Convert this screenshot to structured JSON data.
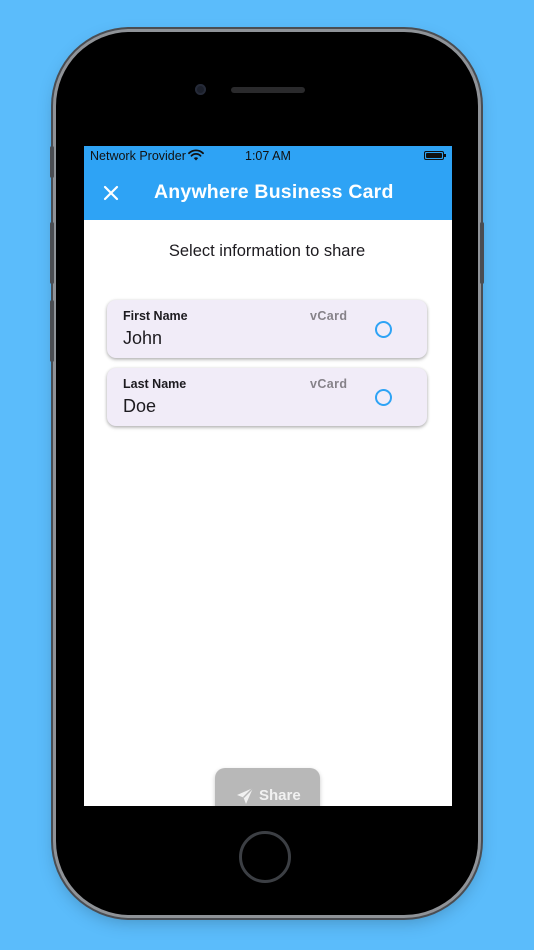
{
  "status_bar": {
    "carrier": "Network Provider",
    "time": "1:07 AM",
    "wifi_icon": "wifi-icon",
    "battery_icon": "battery-icon"
  },
  "app_bar": {
    "title": "Anywhere Business Card",
    "close_icon": "close-icon",
    "color": "#2ea3f5"
  },
  "prompt": "Select information to share",
  "fields": [
    {
      "label": "First Name",
      "tag": "vCard",
      "value": "John",
      "selected": false
    },
    {
      "label": "Last Name",
      "tag": "vCard",
      "value": "Doe",
      "selected": false
    }
  ],
  "share_button": {
    "label": "Share",
    "icon": "send-icon",
    "enabled": false
  },
  "colors": {
    "background": "#5bbcfb",
    "card": "#f1ecf8",
    "accent": "#2ea3f5",
    "button_disabled": "#b8b8b8"
  }
}
